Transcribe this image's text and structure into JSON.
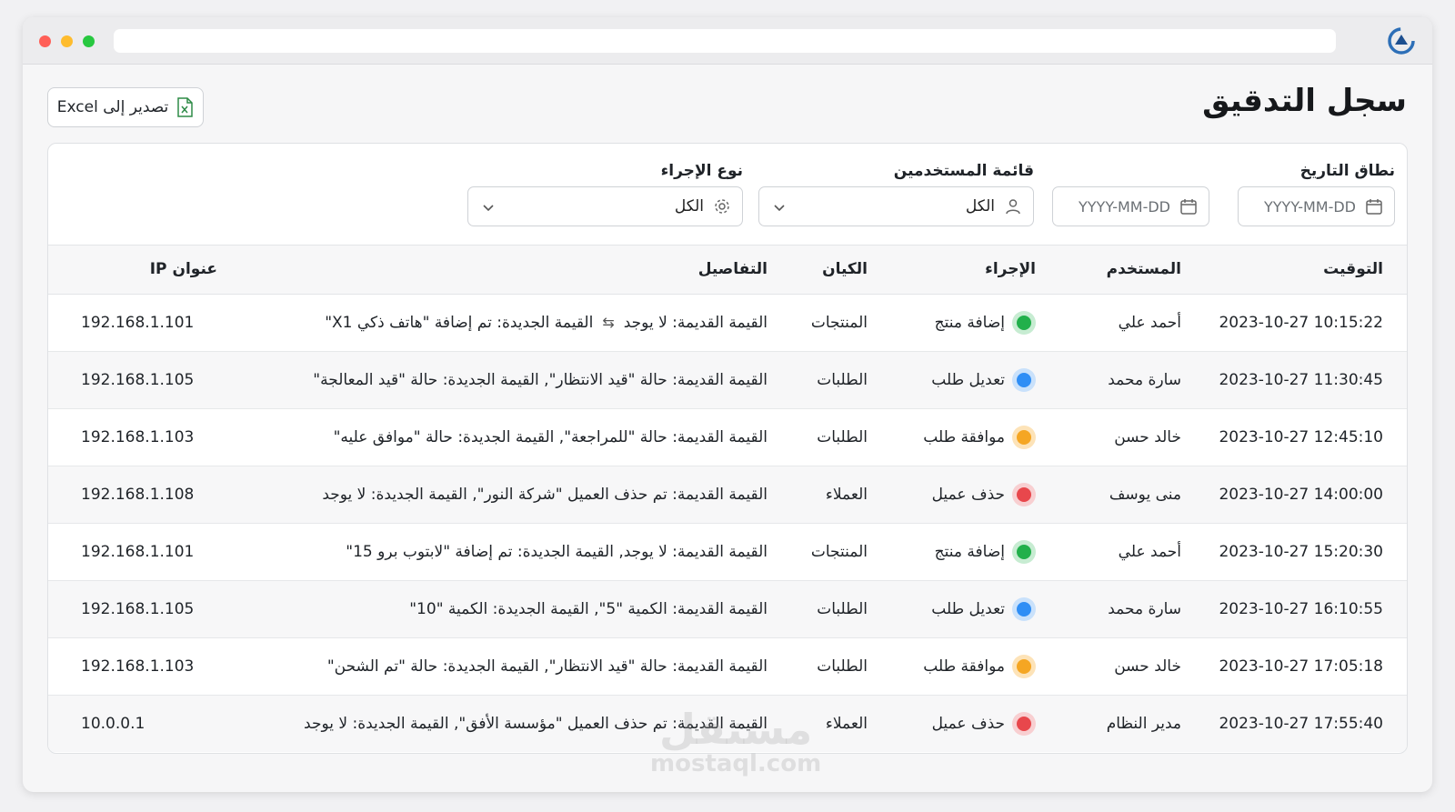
{
  "page": {
    "title": "سجل التدقيق",
    "export_label": "تصدير إلى Excel"
  },
  "filters": {
    "date_range": {
      "label": "نطاق التاريخ",
      "from_placeholder": "YYYY-MM-DD",
      "to_placeholder": "YYYY-MM-DD"
    },
    "users": {
      "label": "قائمة المستخدمين",
      "value": "الكل"
    },
    "action_type": {
      "label": "نوع الإجراء",
      "value": "الكل"
    }
  },
  "table": {
    "headers": {
      "time": "التوقيت",
      "user": "المستخدم",
      "action": "الإجراء",
      "entity": "الكيان",
      "details": "التفاصيل",
      "ip": "عنوان IP"
    },
    "rows": [
      {
        "time": "2023-10-27 10:15:22",
        "user": "أحمد علي",
        "action": "إضافة منتج",
        "status": "green",
        "entity": "المنتجات",
        "details_old": "القيمة القديمة: لا يوجد",
        "details_new": "القيمة الجديدة: تم إضافة \"هاتف ذكي X1\"",
        "ip": "192.168.1.101"
      },
      {
        "time": "2023-10-27 11:30:45",
        "user": "سارة محمد",
        "action": "تعديل طلب",
        "status": "blue",
        "entity": "الطلبات",
        "details": "القيمة القديمة: حالة \"قيد الانتظار\", القيمة الجديدة: حالة \"قيد المعالجة\"",
        "ip": "192.168.1.105"
      },
      {
        "time": "2023-10-27 12:45:10",
        "user": "خالد حسن",
        "action": "موافقة طلب",
        "status": "orange",
        "entity": "الطلبات",
        "details": "القيمة القديمة: حالة \"للمراجعة\", القيمة الجديدة: حالة \"موافق عليه\"",
        "ip": "192.168.1.103"
      },
      {
        "time": "2023-10-27 14:00:00",
        "user": "منى يوسف",
        "action": "حذف عميل",
        "status": "red",
        "entity": "العملاء",
        "details": "القيمة القديمة: تم حذف العميل \"شركة النور\", القيمة الجديدة: لا يوجد",
        "ip": "192.168.1.108"
      },
      {
        "time": "2023-10-27 15:20:30",
        "user": "أحمد علي",
        "action": "إضافة منتج",
        "status": "green",
        "entity": "المنتجات",
        "details": "القيمة القديمة: لا يوجد, القيمة الجديدة: تم إضافة \"لابتوب برو 15\"",
        "ip": "192.168.1.101"
      },
      {
        "time": "2023-10-27 16:10:55",
        "user": "سارة محمد",
        "action": "تعديل طلب",
        "status": "blue",
        "entity": "الطلبات",
        "details": "القيمة القديمة: الكمية \"5\", القيمة الجديدة: الكمية \"10\"",
        "ip": "192.168.1.105"
      },
      {
        "time": "2023-10-27 17:05:18",
        "user": "خالد حسن",
        "action": "موافقة طلب",
        "status": "orange",
        "entity": "الطلبات",
        "details": "القيمة القديمة: حالة \"قيد الانتظار\", القيمة الجديدة: حالة \"تم الشحن\"",
        "ip": "192.168.1.103"
      },
      {
        "time": "2023-10-27 17:55:40",
        "user": "مدير النظام",
        "action": "حذف عميل",
        "status": "red",
        "entity": "العملاء",
        "details": "القيمة القديمة: تم حذف العميل \"مؤسسة الأفق\", القيمة الجديدة: لا يوجد",
        "ip": "10.0.0.1"
      }
    ]
  },
  "status_colors": {
    "green": {
      "dot": "#22b04b",
      "ring": "#c7ecd2"
    },
    "blue": {
      "dot": "#2f8ef5",
      "ring": "#c9e1fb"
    },
    "orange": {
      "dot": "#f5a623",
      "ring": "#fde3b8"
    },
    "red": {
      "dot": "#e8474c",
      "ring": "#f8cfd1"
    }
  },
  "watermark": {
    "main": "مستقل",
    "sub": "mostaql.com"
  }
}
